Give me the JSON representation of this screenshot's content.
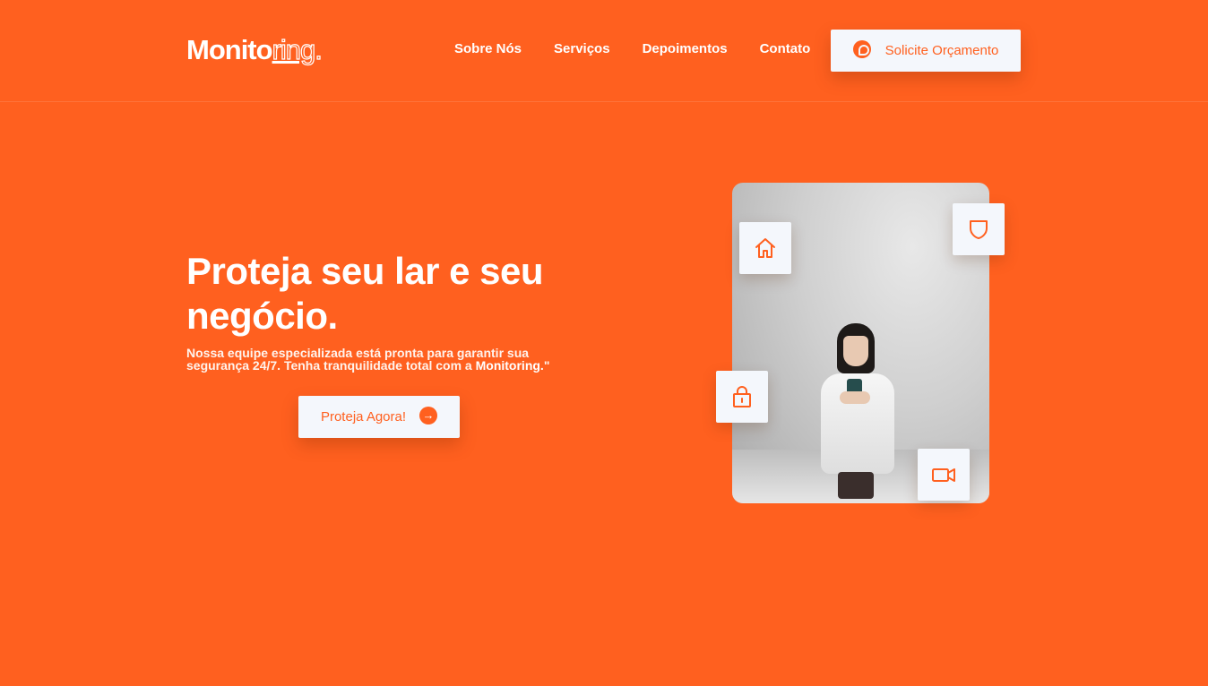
{
  "brand": {
    "logo_main": "Monito",
    "logo_accent": "ring",
    "logo_dot": "."
  },
  "nav": {
    "items": [
      "Sobre Nós",
      "Serviços",
      "Depoimentos",
      "Contato"
    ]
  },
  "header": {
    "quote_button": "Solicite Orçamento",
    "quote_icon": "whatsapp-icon"
  },
  "hero": {
    "title": "Proteja seu lar e seu negócio.",
    "description_start": "Nossa equipe especializada está pronta para garantir sua segurança 24/7. Tenha tranquilidade total com a ",
    "description_brand": "Monitoring.",
    "description_end": "\"",
    "cta_label": "Proteja Agora!",
    "cta_icon": "arrow-right-icon"
  },
  "feature_icons": [
    "home-icon",
    "shield-icon",
    "lock-icon",
    "video-camera-icon"
  ],
  "colors": {
    "brand_orange": "#ff601f",
    "card_bg": "#f4f7fc",
    "text": "#ffffff"
  }
}
